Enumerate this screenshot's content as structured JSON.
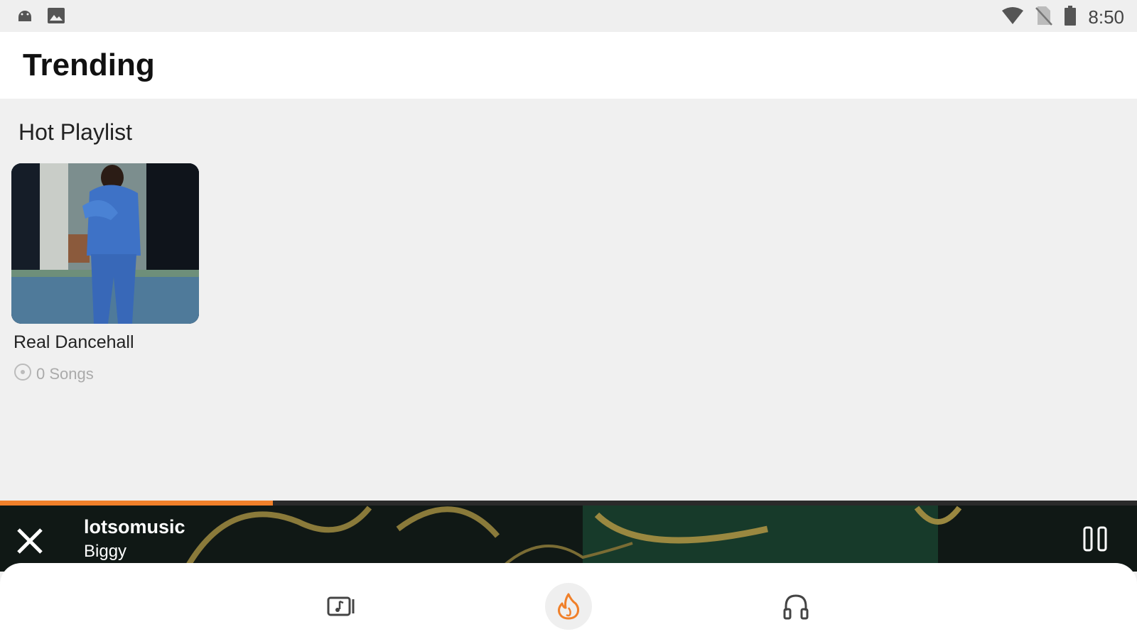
{
  "status_bar": {
    "time": "8:50",
    "left_icons": [
      "android-notification-icon",
      "image-notification-icon"
    ],
    "right_icons": [
      "wifi-icon",
      "no-sim-icon",
      "battery-icon"
    ]
  },
  "header": {
    "title": "Trending"
  },
  "section": {
    "title": "Hot Playlist"
  },
  "playlists": [
    {
      "name": "Real Dancehall",
      "songs_label": "0 Songs",
      "thumbnail": "man-in-blue-suit-photo"
    }
  ],
  "player": {
    "title": "lotsomusic",
    "artist": "Biggy",
    "progress": 0.24,
    "icons": {
      "close": "close-icon",
      "pause": "pause-icon"
    }
  },
  "bottom_nav": {
    "items": [
      {
        "name": "music-library-icon",
        "active": false
      },
      {
        "name": "trending-fire-icon",
        "active": true
      },
      {
        "name": "headphones-icon",
        "active": false
      }
    ]
  },
  "colors": {
    "accent": "#f0802a",
    "background": "#f0f0f0",
    "appbar": "#ffffff",
    "player_bg": "#0e1412"
  }
}
